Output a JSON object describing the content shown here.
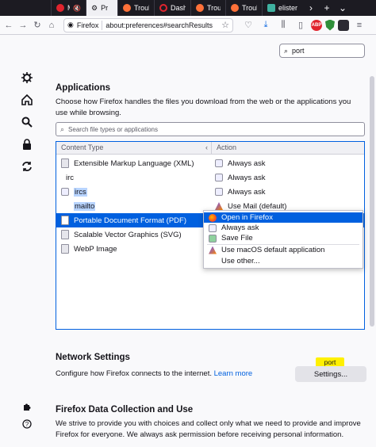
{
  "tabs": [
    {
      "label": "Me",
      "color": "#e0242e",
      "active": false,
      "muted": true
    },
    {
      "label": "Pr",
      "color": "#5b5b66",
      "active": true
    },
    {
      "label": "Troubl",
      "color": "#ff7139",
      "active": false
    },
    {
      "label": "Dashb",
      "color": "#e0242e",
      "active": false
    },
    {
      "label": "Troubl",
      "color": "#ff7139",
      "active": false
    },
    {
      "label": "Troubl",
      "color": "#ff7139",
      "active": false
    },
    {
      "label": "elister",
      "color": "#3fb1a0",
      "active": false
    }
  ],
  "url": {
    "identity": "Firefox",
    "address": "about:preferences#searchResults"
  },
  "search": {
    "value": "port"
  },
  "applications": {
    "heading": "Applications",
    "description": "Choose how Firefox handles the files you download from the web or the applications you use while browsing.",
    "filter_placeholder": "Search file types or applications",
    "col_content": "Content Type",
    "col_action": "Action",
    "rows": [
      {
        "type": "Extensible Markup Language (XML)",
        "action": "Always ask"
      },
      {
        "type": "irc",
        "action": "Always ask"
      },
      {
        "type": "ircs",
        "action": "Always ask"
      },
      {
        "type": "mailto",
        "action": "Use Mail (default)"
      },
      {
        "type": "Portable Document Format (PDF)",
        "action": "Open in Firefox"
      },
      {
        "type": "Scalable Vector Graphics (SVG)",
        "action": ""
      },
      {
        "type": "WebP Image",
        "action": ""
      }
    ],
    "menu": [
      "Open in Firefox",
      "Always ask",
      "Save File",
      "Use macOS default application",
      "Use other..."
    ]
  },
  "network": {
    "heading": "Network Settings",
    "description": "Configure how Firefox connects to the internet.",
    "learn_more": "Learn more",
    "tag": "port",
    "button": "Settings..."
  },
  "data_collection": {
    "heading": "Firefox Data Collection and Use",
    "description": "We strive to provide you with choices and collect only what we need to provide and improve Firefox for everyone. We always ask permission before receiving personal information."
  },
  "icons": {
    "sidebar": [
      "gear-icon",
      "home-icon",
      "search-icon",
      "lock-icon",
      "sync-icon",
      "puzzle-icon",
      "help-icon"
    ]
  }
}
